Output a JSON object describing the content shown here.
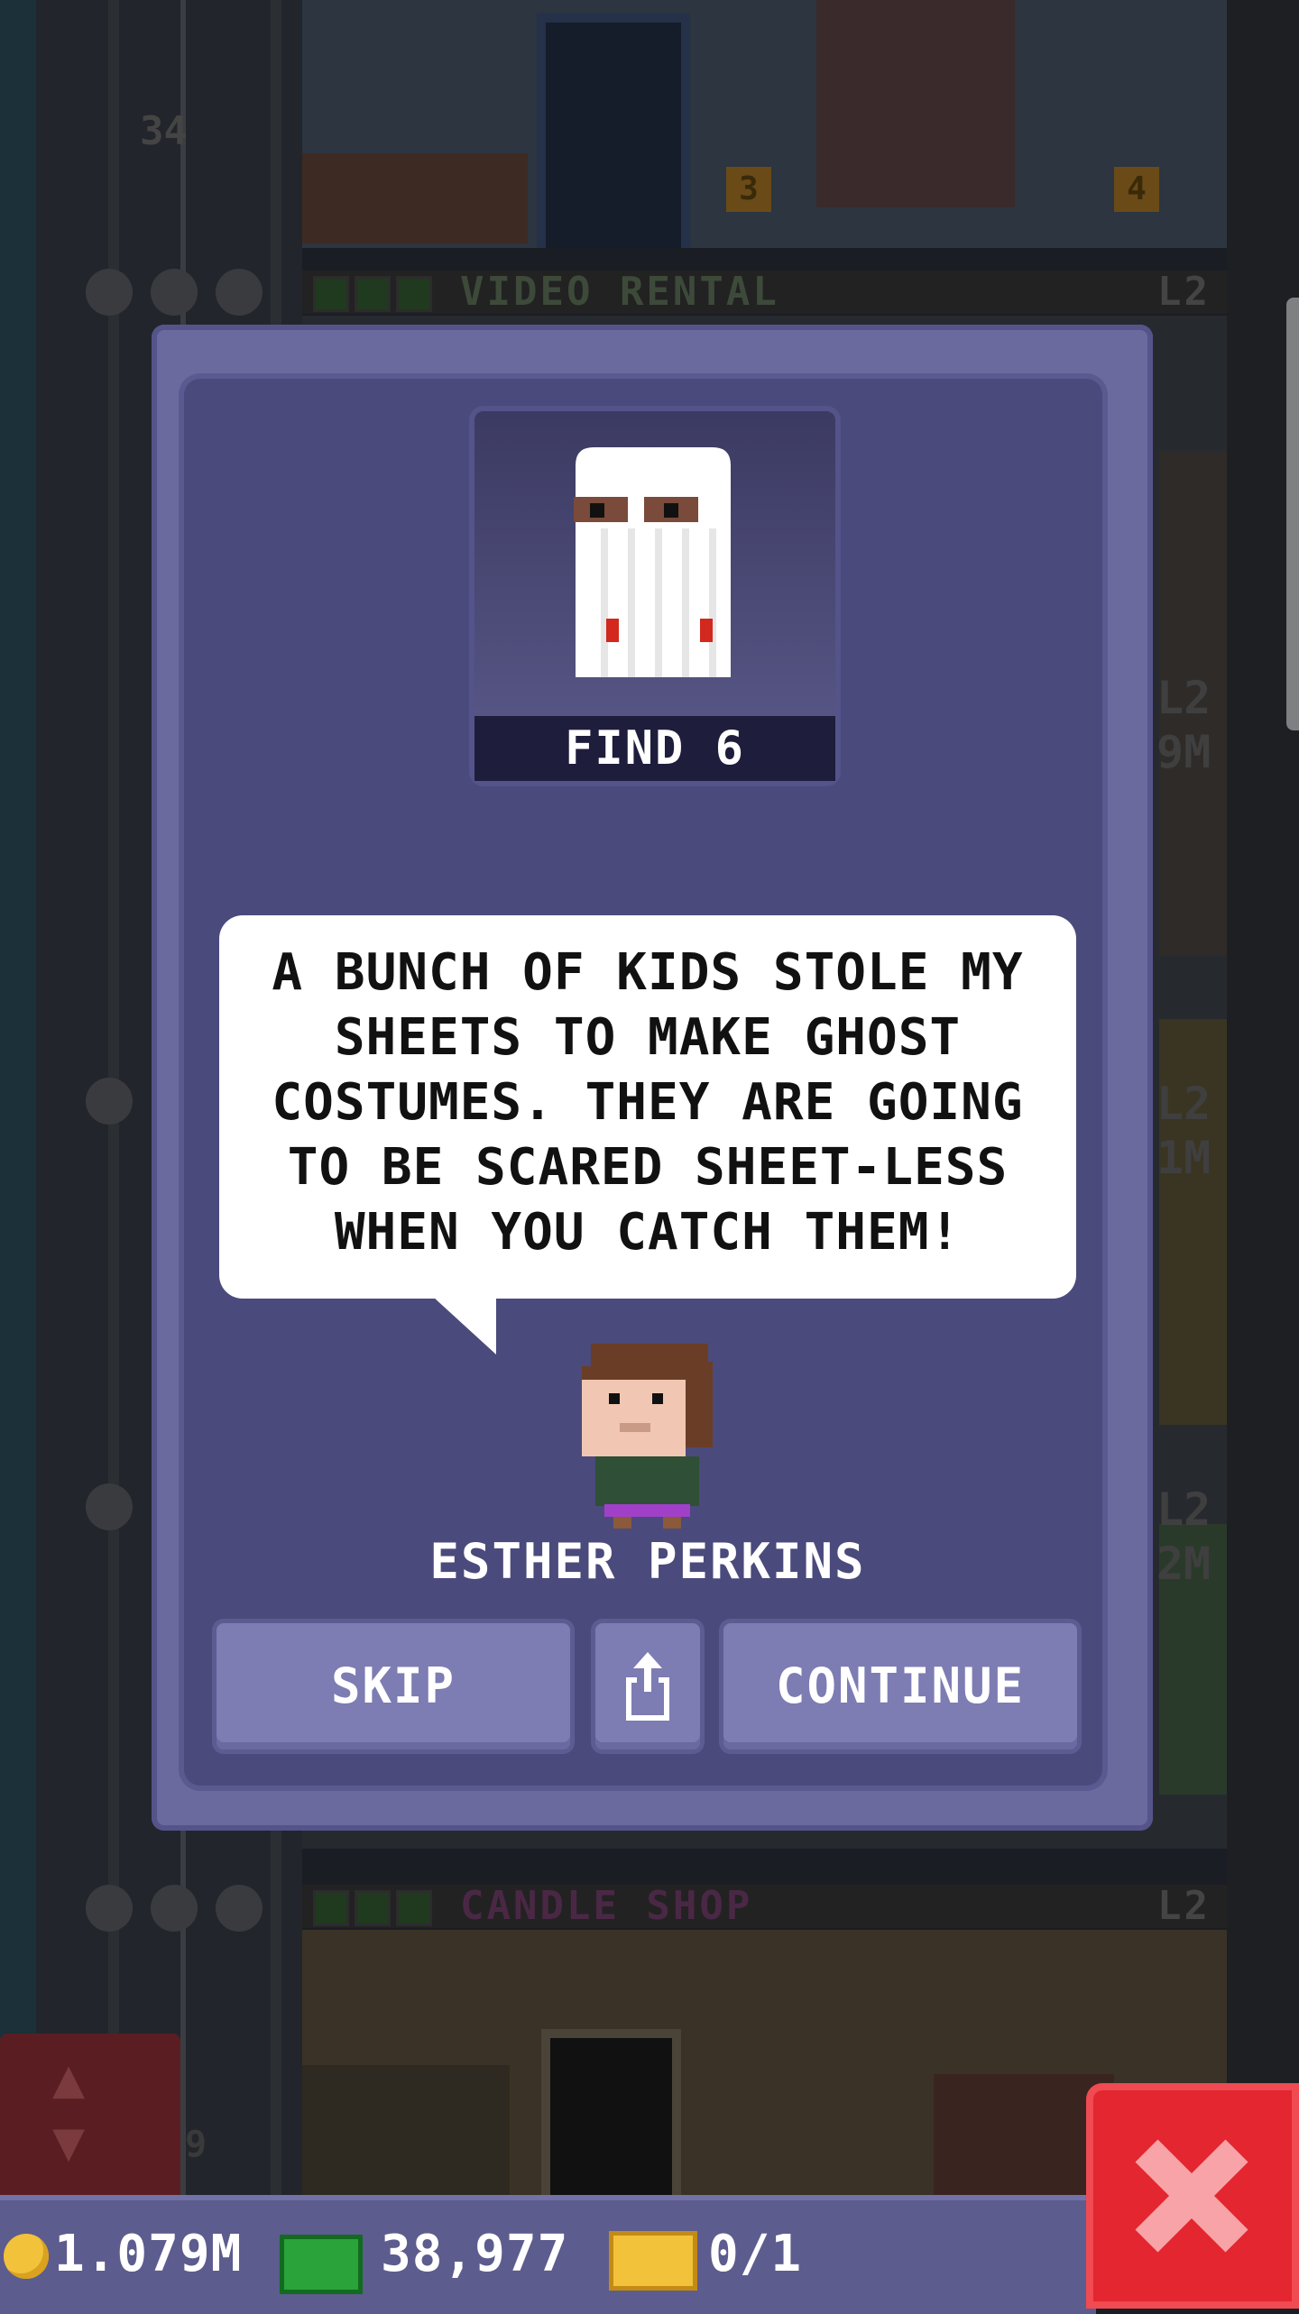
{
  "background": {
    "top_floor_number": "34",
    "top_floor_name": "VIDEO RENTAL",
    "top_floor_level": "L2",
    "top_floor_door_badges": [
      "3",
      "4"
    ],
    "bottom_floor_name": "CANDLE SHOP",
    "bottom_floor_level": "L2",
    "side_levels": [
      "L2",
      "9M",
      "L2",
      "1M",
      "L2",
      "2M"
    ],
    "elevator_floor_hint": "9"
  },
  "dialog": {
    "mission_label": "FIND 6",
    "quote": "A BUNCH OF KIDS STOLE MY SHEETS TO MAKE GHOST COSTUMES. THEY ARE GOING TO BE SCARED SHEET-LESS WHEN YOU CATCH THEM!",
    "npc_name": "ESTHER PERKINS",
    "buttons": {
      "skip": "SKIP",
      "continue": "CONTINUE"
    }
  },
  "status_bar": {
    "coins": "1.079M",
    "bux": "38,977",
    "tickets": "0/1"
  },
  "colors": {
    "dialog_frame": "#6b6a9e",
    "dialog_inner": "#4b4a7c",
    "button": "#7d7cb3",
    "close_red": "#e3262f",
    "coin": "#f2c23a",
    "bux_green": "#2aa33a"
  },
  "icons": [
    "ghost-icon",
    "npc-avatar",
    "share-icon",
    "coin-icon",
    "bux-icon",
    "ticket-icon",
    "close-icon",
    "elevator-arrows-icon",
    "star-icon"
  ]
}
